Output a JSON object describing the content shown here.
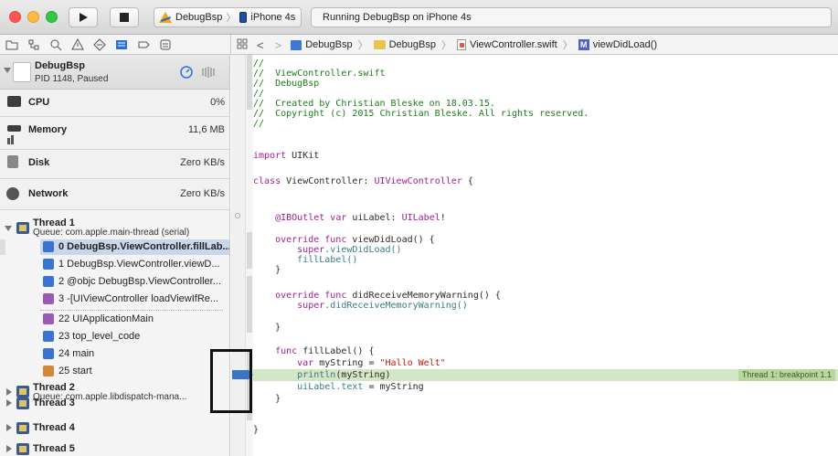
{
  "toolbar": {
    "scheme_name": "DebugBsp",
    "device_name": "iPhone 4s",
    "status_text": "Running DebugBsp on iPhone 4s"
  },
  "jumpbar": {
    "project": "DebugBsp",
    "group": "DebugBsp",
    "file": "ViewController.swift",
    "method": "viewDidLoad()",
    "method_badge": "M"
  },
  "debug_navigator": {
    "process": {
      "name": "DebugBsp",
      "status": "PID 1148, Paused"
    },
    "gauges": [
      {
        "label": "CPU",
        "value": "0%"
      },
      {
        "label": "Memory",
        "value": "11,6 MB"
      },
      {
        "label": "Disk",
        "value": "Zero KB/s"
      },
      {
        "label": "Network",
        "value": "Zero KB/s"
      }
    ],
    "threads": [
      {
        "name": "Thread 1",
        "queue": "Queue: com.apple.main-thread (serial)",
        "expanded": true
      },
      {
        "name": "Thread 2",
        "queue": "Queue: com.apple.libdispatch-mana...",
        "expanded": false
      },
      {
        "name": "Thread 3"
      },
      {
        "name": "Thread 4"
      },
      {
        "name": "Thread 5"
      }
    ],
    "frames": [
      {
        "label": "0 DebugBsp.ViewController.fillLab...",
        "selected": true
      },
      {
        "label": "1 DebugBsp.ViewController.viewD..."
      },
      {
        "label": "2 @objc DebugBsp.ViewController..."
      },
      {
        "label": "3 -[UIViewController loadViewIfRe..."
      },
      {
        "label": "22 UIApplicationMain"
      },
      {
        "label": "23 top_level_code"
      },
      {
        "label": "24 main"
      },
      {
        "label": "25 start"
      }
    ]
  },
  "code": {
    "l1": "//",
    "l2": "//  ViewController.swift",
    "l3": "//  DebugBsp",
    "l4": "//",
    "l5": "//  Created by Christian Bleske on 18.03.15.",
    "l6": "//  Copyright (c) 2015 Christian Bleske. All rights reserved.",
    "l7": "//",
    "import_kw": "import",
    "import_mod": " UIKit",
    "class_kw": "class",
    "class_rest": " ViewController: ",
    "class_super": "UIViewController",
    "class_brace": " {",
    "outlet_attr": "    @IBOutlet",
    "outlet_var": " var",
    "outlet_rest": " uiLabel: ",
    "outlet_type": "UILabel",
    "outlet_bang": "!",
    "vdl_kw": "    override func",
    "vdl_rest": " viewDidLoad() {",
    "vdl_super_kw": "        super",
    "vdl_super_rest": ".viewDidLoad()",
    "vdl_call": "        fillLabel()",
    "close1": "    }",
    "drm_kw": "    override func",
    "drm_rest": " didReceiveMemoryWarning() {",
    "drm_super_kw": "        super",
    "drm_super_rest": ".didReceiveMemoryWarning()",
    "close2": "    }",
    "fl_kw": "    func",
    "fl_rest": " fillLabel() {",
    "var_kw": "        var",
    "var_rest": " myString = ",
    "var_str": "\"Hallo Welt\"",
    "println_fn": "        println",
    "println_rest": "(myString)",
    "uilabel_pre": "        uiLabel.",
    "uilabel_prop": "text",
    "uilabel_rest": " = myString",
    "close3": "    }",
    "close4": "}"
  },
  "breakpoint_label": "Thread 1: breakpoint 1.1",
  "colors": {
    "comment": "#1d7d1b",
    "keyword": "#a31f8e",
    "string": "#c41a16",
    "highlight": "#d3e6c6",
    "breakpoint": "#3a74c5"
  }
}
